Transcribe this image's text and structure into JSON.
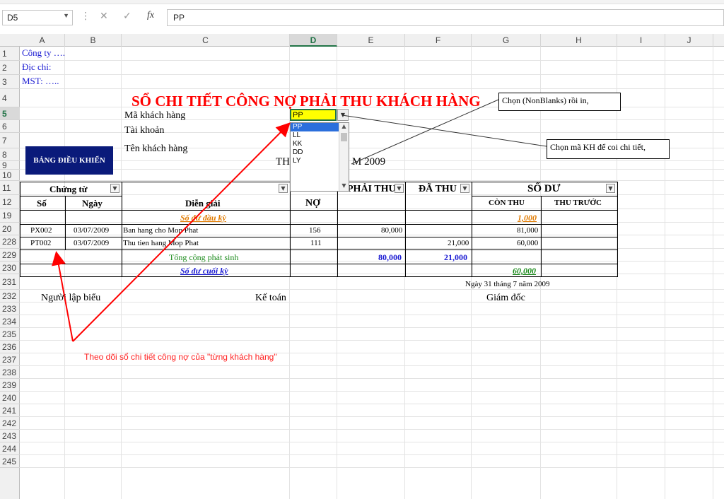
{
  "formula_bar": {
    "name_box": "D5",
    "cancel_glyph": "✕",
    "enter_glyph": "✓",
    "fx_label": "fx",
    "formula": "PP"
  },
  "columns": [
    "A",
    "B",
    "C",
    "D",
    "E",
    "F",
    "G",
    "H",
    "I",
    "J"
  ],
  "selected_column": "D",
  "rows": [
    "1",
    "2",
    "3",
    "4",
    "5",
    "6",
    "7",
    "8",
    "9",
    "10",
    "11",
    "12",
    "19",
    "20",
    "228",
    "229",
    "230",
    "231",
    "232",
    "233",
    "234",
    "235",
    "236",
    "237",
    "238",
    "239",
    "240",
    "241",
    "242",
    "243",
    "244",
    "245"
  ],
  "selected_row": "5",
  "company": {
    "line1": "Công ty ….",
    "line2": "Địc chỉ:",
    "line3": "MST: ….."
  },
  "title": "SỔ CHI TIẾT CÔNG NỢ PHẢI THU KHÁCH HÀNG",
  "fields": {
    "customer_code_label": "Mã khách hàng",
    "account_label": "Tài khoản",
    "customer_name_label": "Tên khách hàng",
    "customer_code_value": "PP"
  },
  "dashboard_button": "BẢNG ĐIỀU KHIỂN",
  "period_left": "TH",
  "period_right": "M 2009",
  "dropdown": {
    "options": [
      "PP",
      "LL",
      "KK",
      "DD",
      "LY"
    ],
    "highlighted": "PP"
  },
  "table": {
    "header_voucher": "Chứng từ",
    "header_no": "Số",
    "header_date": "Ngày",
    "header_desc": "Diễn giải",
    "header_debit": "NỢ",
    "header_receivable": "PHẢI THU",
    "header_collected": "ĐÃ THU",
    "header_balance": "SỐ DƯ",
    "header_remaining": "CÒN THU",
    "header_advance": "THU TRƯỚC",
    "opening_label": "Số dư đầu kỳ",
    "opening_remaining": "1,000",
    "rows": [
      {
        "no": "PX002",
        "date": "03/07/2009",
        "desc": "Ban hang cho Mop Phat",
        "debit": "156",
        "receivable": "80,000",
        "collected": "",
        "remaining": "81,000"
      },
      {
        "no": "PT002",
        "date": "03/07/2009",
        "desc": "Thu tien hang Mop Phat",
        "debit": "111",
        "receivable": "",
        "collected": "21,000",
        "remaining": "60,000"
      }
    ],
    "total_label": "Tổng cộng phát sinh",
    "total_receivable": "80,000",
    "total_collected": "21,000",
    "closing_label": "Số dư cuối kỳ",
    "closing_remaining": "60,000"
  },
  "footer": {
    "date_line": "Ngày 31 tháng 7 năm 2009",
    "preparer": "Người lập biểu",
    "accountant": "Kế toán",
    "director": "Giám đốc"
  },
  "callouts": {
    "nonblanks": "Chọn (NonBlanks) rồi in,",
    "choose_code": "Chọn mã KH để coi chi tiết,"
  },
  "annotation_text": "Theo dõi sổ chi tiết công nợ của \"từng khách hàng\"",
  "colors": {
    "title_red": "#ff0000",
    "company_blue": "#1a1ad2",
    "dashboard_navy": "#0a1a7a",
    "selected_yellow": "#ffff00",
    "opening_orange": "#e07a00",
    "total_green": "#1a8a1a",
    "closing_blue": "#1a1ad2",
    "arrow_red": "#ff0000"
  }
}
